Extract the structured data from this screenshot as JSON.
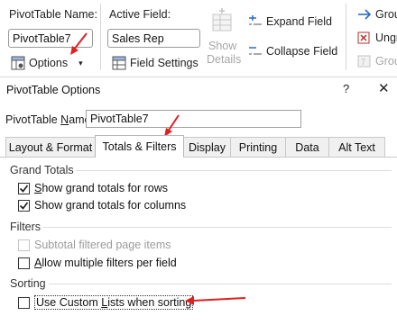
{
  "ribbon": {
    "pivottable_group": {
      "name_label": "PivotTable Name:",
      "name_value": "PivotTable7",
      "options_label": "Options"
    },
    "active_field_group": {
      "label": "Active Field:",
      "field_value": "Sales Rep",
      "field_settings_label": "Field Settings",
      "show_details_line1": "Show",
      "show_details_line2": "Details"
    },
    "expand_group": {
      "expand_label": "Expand Field",
      "collapse_label": "Collapse Field"
    },
    "group_group": {
      "group_label": "Grou",
      "ungroup_label": "Ungr",
      "group_field_label": "Grou"
    }
  },
  "dialog": {
    "title": "PivotTable Options",
    "help": "?",
    "close": "✕",
    "name_label_pre": "PivotTable ",
    "name_label_u": "N",
    "name_label_post": "ame:",
    "name_value": "PivotTable7",
    "tabs": [
      {
        "label": "Layout & Format"
      },
      {
        "label": "Totals & Filters"
      },
      {
        "label": "Display"
      },
      {
        "label": "Printing"
      },
      {
        "label": "Data"
      },
      {
        "label": "Alt Text"
      }
    ],
    "active_tab": "Totals & Filters",
    "grand_totals": {
      "title": "Grand Totals",
      "rows": {
        "checked": true,
        "pre": "",
        "u": "S",
        "post": "how grand totals for rows"
      },
      "columns": {
        "checked": true,
        "pre": "Show ",
        "u": "g",
        "post": "rand totals for columns"
      }
    },
    "filters": {
      "title": "Filters",
      "subtotal": {
        "checked": false,
        "disabled": true,
        "label": "Subtotal filtered page items"
      },
      "multiple": {
        "checked": false,
        "pre": "",
        "u": "A",
        "post": "llow multiple filters per field"
      }
    },
    "sorting": {
      "title": "Sorting",
      "custom_lists": {
        "checked": false,
        "pre": "Use Custom ",
        "u": "L",
        "post": "ists when sorting"
      }
    }
  },
  "colors": {
    "arrow": "#e02020",
    "accent_blue": "#2b6cc4",
    "check": "#1a1a1a",
    "disabled": "#9b9b9b"
  }
}
